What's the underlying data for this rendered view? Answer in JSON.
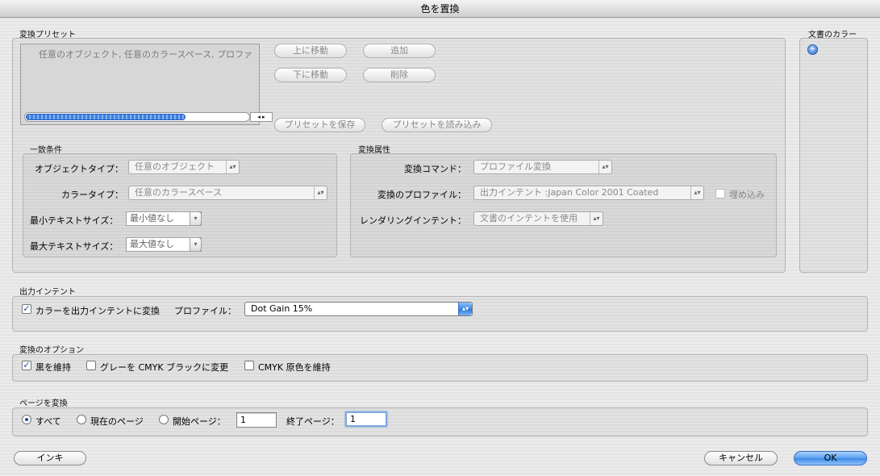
{
  "window": {
    "title": "色を置換"
  },
  "presets": {
    "label": "変換プリセット",
    "list_items": [
      "任意のオブジェクト, 任意のカラースペース, プロファ"
    ],
    "move_up_label": "上に移動",
    "move_down_label": "下に移動",
    "add_label": "追加",
    "delete_label": "削除",
    "save_label": "プリセットを保存",
    "load_label": "プリセットを読み込み"
  },
  "doc_colors": {
    "label": "文書のカラー"
  },
  "match": {
    "label": "一致条件",
    "object_type_label": "オブジェクトタイプ：",
    "object_type_value": "任意のオブジェクト",
    "color_type_label": "カラータイプ：",
    "color_type_value": "任意のカラースペース",
    "min_text_label": "最小テキストサイズ：",
    "min_text_value": "最小値なし",
    "max_text_label": "最大テキストサイズ：",
    "max_text_value": "最大値なし"
  },
  "convert": {
    "label": "変換属性",
    "command_label": "変換コマンド：",
    "command_value": "プロファイル変換",
    "profile_label": "変換のプロファイル：",
    "profile_value": "出力インテント :Japan Color 2001 Coated",
    "embed_label": "埋め込み",
    "intent_label": "レンダリングインテント：",
    "intent_value": "文書のインテントを使用"
  },
  "output_intent": {
    "label": "出力インテント",
    "convert_checkbox_label": "カラーを出力インテントに変換",
    "profile_label": "プロファイル：",
    "profile_value": "Dot Gain 15%"
  },
  "options": {
    "label": "変換のオプション",
    "keep_black": "黒を維持",
    "gray_to_cmyk": "グレーを CMYK ブラックに変更",
    "keep_cmyk": "CMYK 原色を維持"
  },
  "pages": {
    "label": "ページを変換",
    "all": "すべて",
    "current": "現在のページ",
    "start_label": "開始ページ：",
    "start_value": "1",
    "end_label": "終了ページ：",
    "end_value": "1"
  },
  "footer": {
    "ink_label": "インキ",
    "cancel_label": "キャンセル",
    "ok_label": "OK"
  }
}
